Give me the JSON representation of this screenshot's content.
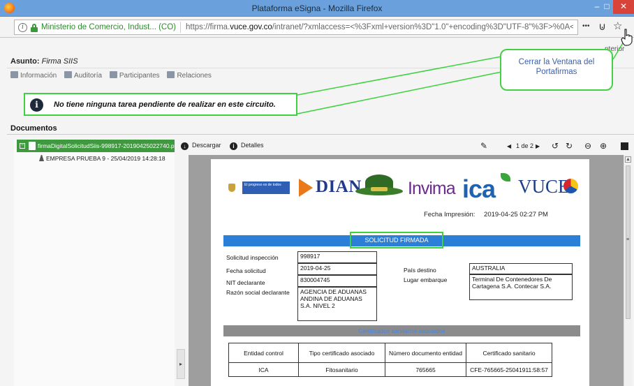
{
  "window": {
    "title": "Plataforma eSigna - Mozilla Firefox",
    "min_glyph": "–",
    "max_glyph": "□",
    "close_glyph": "✕"
  },
  "addressbar": {
    "site_identity": "Ministerio de Comercio, Indust... (CO)",
    "url_prefix": "https://firma.",
    "url_domain": "vuce.gov.co",
    "url_rest": "/intranet/?xmlaccess=<%3Fxml+version%3D\"1.0\"+encoding%3D\"UTF-8\"%3F>%0A<esignaAuth",
    "more_glyph": "•••",
    "pocket_glyph": "⊍",
    "star_glyph": "☆"
  },
  "page": {
    "anterior_label": "nterior",
    "asunto_label": "Asunto:",
    "asunto_value": "Firma SIIS",
    "tabs": [
      {
        "label": "Información"
      },
      {
        "label": "Auditoría"
      },
      {
        "label": "Participantes"
      },
      {
        "label": "Relaciones"
      }
    ],
    "notice_text": "No tiene ninguna tarea pendiente de realizar en este circuito.",
    "callout_text": "Cerrar la Ventana del Portafirmas",
    "documents_heading": "Documentos"
  },
  "tree": {
    "selected_file": "firmaDigitalSolicitudSiis-998917-20190425022740.p",
    "signature_entry": "EMPRESA PRUEBA 9 - 25/04/2019 14:28:18"
  },
  "viewer_toolbar": {
    "download_label": "Descargar",
    "details_label": "Detalles",
    "page_indicator": "1 de 2",
    "prev_glyph": "◀",
    "next_glyph": "▶"
  },
  "pdf": {
    "dian_text": "DIAN",
    "invima_text": "Invima",
    "ica_text": "ica",
    "vuce_text": "VUCE",
    "gobierno_text": "El progreso es de todos",
    "fecha_label": "Fecha Impresión:",
    "fecha_value": "2019-04-25 02:27 PM",
    "solicitud_heading": "SOLICITUD FIRMADA",
    "fields": {
      "solicitud_inspeccion_label": "Solicitud inspección",
      "solicitud_inspeccion_value": "998917",
      "fecha_solicitud_label": "Fecha solicitud",
      "fecha_solicitud_value": "2019-04-25",
      "nit_label": "NIT declarante",
      "nit_value": "830004745",
      "razon_label": "Razón social declarante",
      "razon_value": "AGENCIA DE ADUANAS ANDINA DE ADUANAS S.A. NIVEL 2",
      "pais_label": "País destino",
      "pais_value": "AUSTRALIA",
      "lugar_label": "Lugar embarque",
      "lugar_value": "Terminal De Contenedores De Cartagena S.A. Contecar S.A."
    },
    "certificados_heading": "Certificados sanitarios asociados",
    "cert_table": {
      "headers": [
        "Entidad control",
        "Tipo certificado asociado",
        "Número documento entidad",
        "Certificado sanitario"
      ],
      "rows": [
        [
          "ICA",
          "Fitosanitario",
          "765665",
          "CFE-765665-25041911:58:57"
        ]
      ]
    }
  },
  "colors": {
    "titlebar": "#6aa1dd",
    "highlight_green": "#3fd13f",
    "tree_selected": "#3f9a3f",
    "pdf_blue_band": "#2b7fd6",
    "callout_text": "#3a5fa8"
  }
}
